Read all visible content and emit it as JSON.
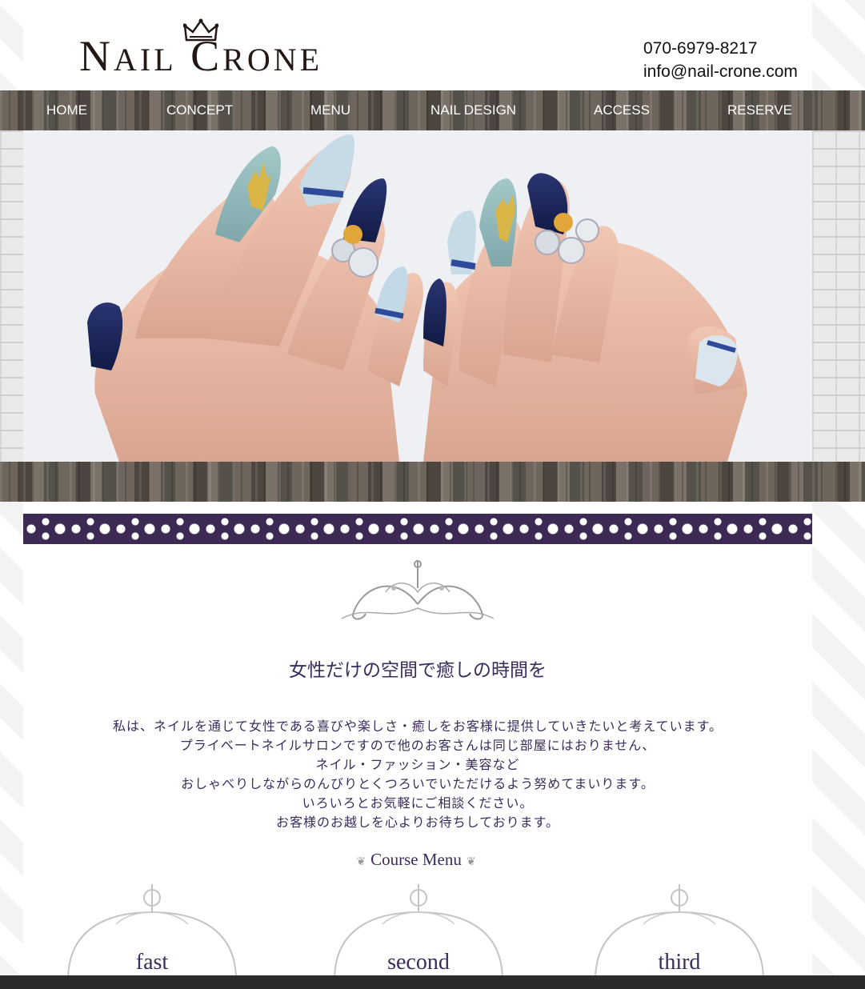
{
  "header": {
    "logo_text_1": "N",
    "logo_text_2": "AIL",
    "logo_text_3": "C",
    "logo_text_4": "RONE",
    "phone": "070-6979-8217",
    "email": "info@nail-crone.com"
  },
  "nav": {
    "items": [
      {
        "label": "HOME"
      },
      {
        "label": "CONCEPT"
      },
      {
        "label": "MENU"
      },
      {
        "label": "NAIL DESIGN"
      },
      {
        "label": "ACCESS"
      },
      {
        "label": "RESERVE"
      }
    ]
  },
  "main": {
    "tagline": "女性だけの空間で癒しの時間を",
    "intro_lines": [
      "私は、ネイルを通じて女性である喜びや楽しさ・癒しをお客様に提供していきたいと考えています。",
      "プライベートネイルサロンですので他のお客さんは同じ部屋にはおりません、",
      "ネイル・ファッション・美容など",
      "おしゃべりしながらのんびりとくつろいでいただけるよう努めてまいります。",
      "いろいろとお気軽にご相談ください。",
      "お客様のお越しを心よりお待ちしております。"
    ],
    "course_menu_title": "Course Menu",
    "courses": [
      {
        "label": "fast"
      },
      {
        "label": "second"
      },
      {
        "label": "third"
      }
    ]
  },
  "colors": {
    "accent": "#3a2c5c",
    "wood": "#5d554e",
    "damask": "#3c2a55"
  }
}
